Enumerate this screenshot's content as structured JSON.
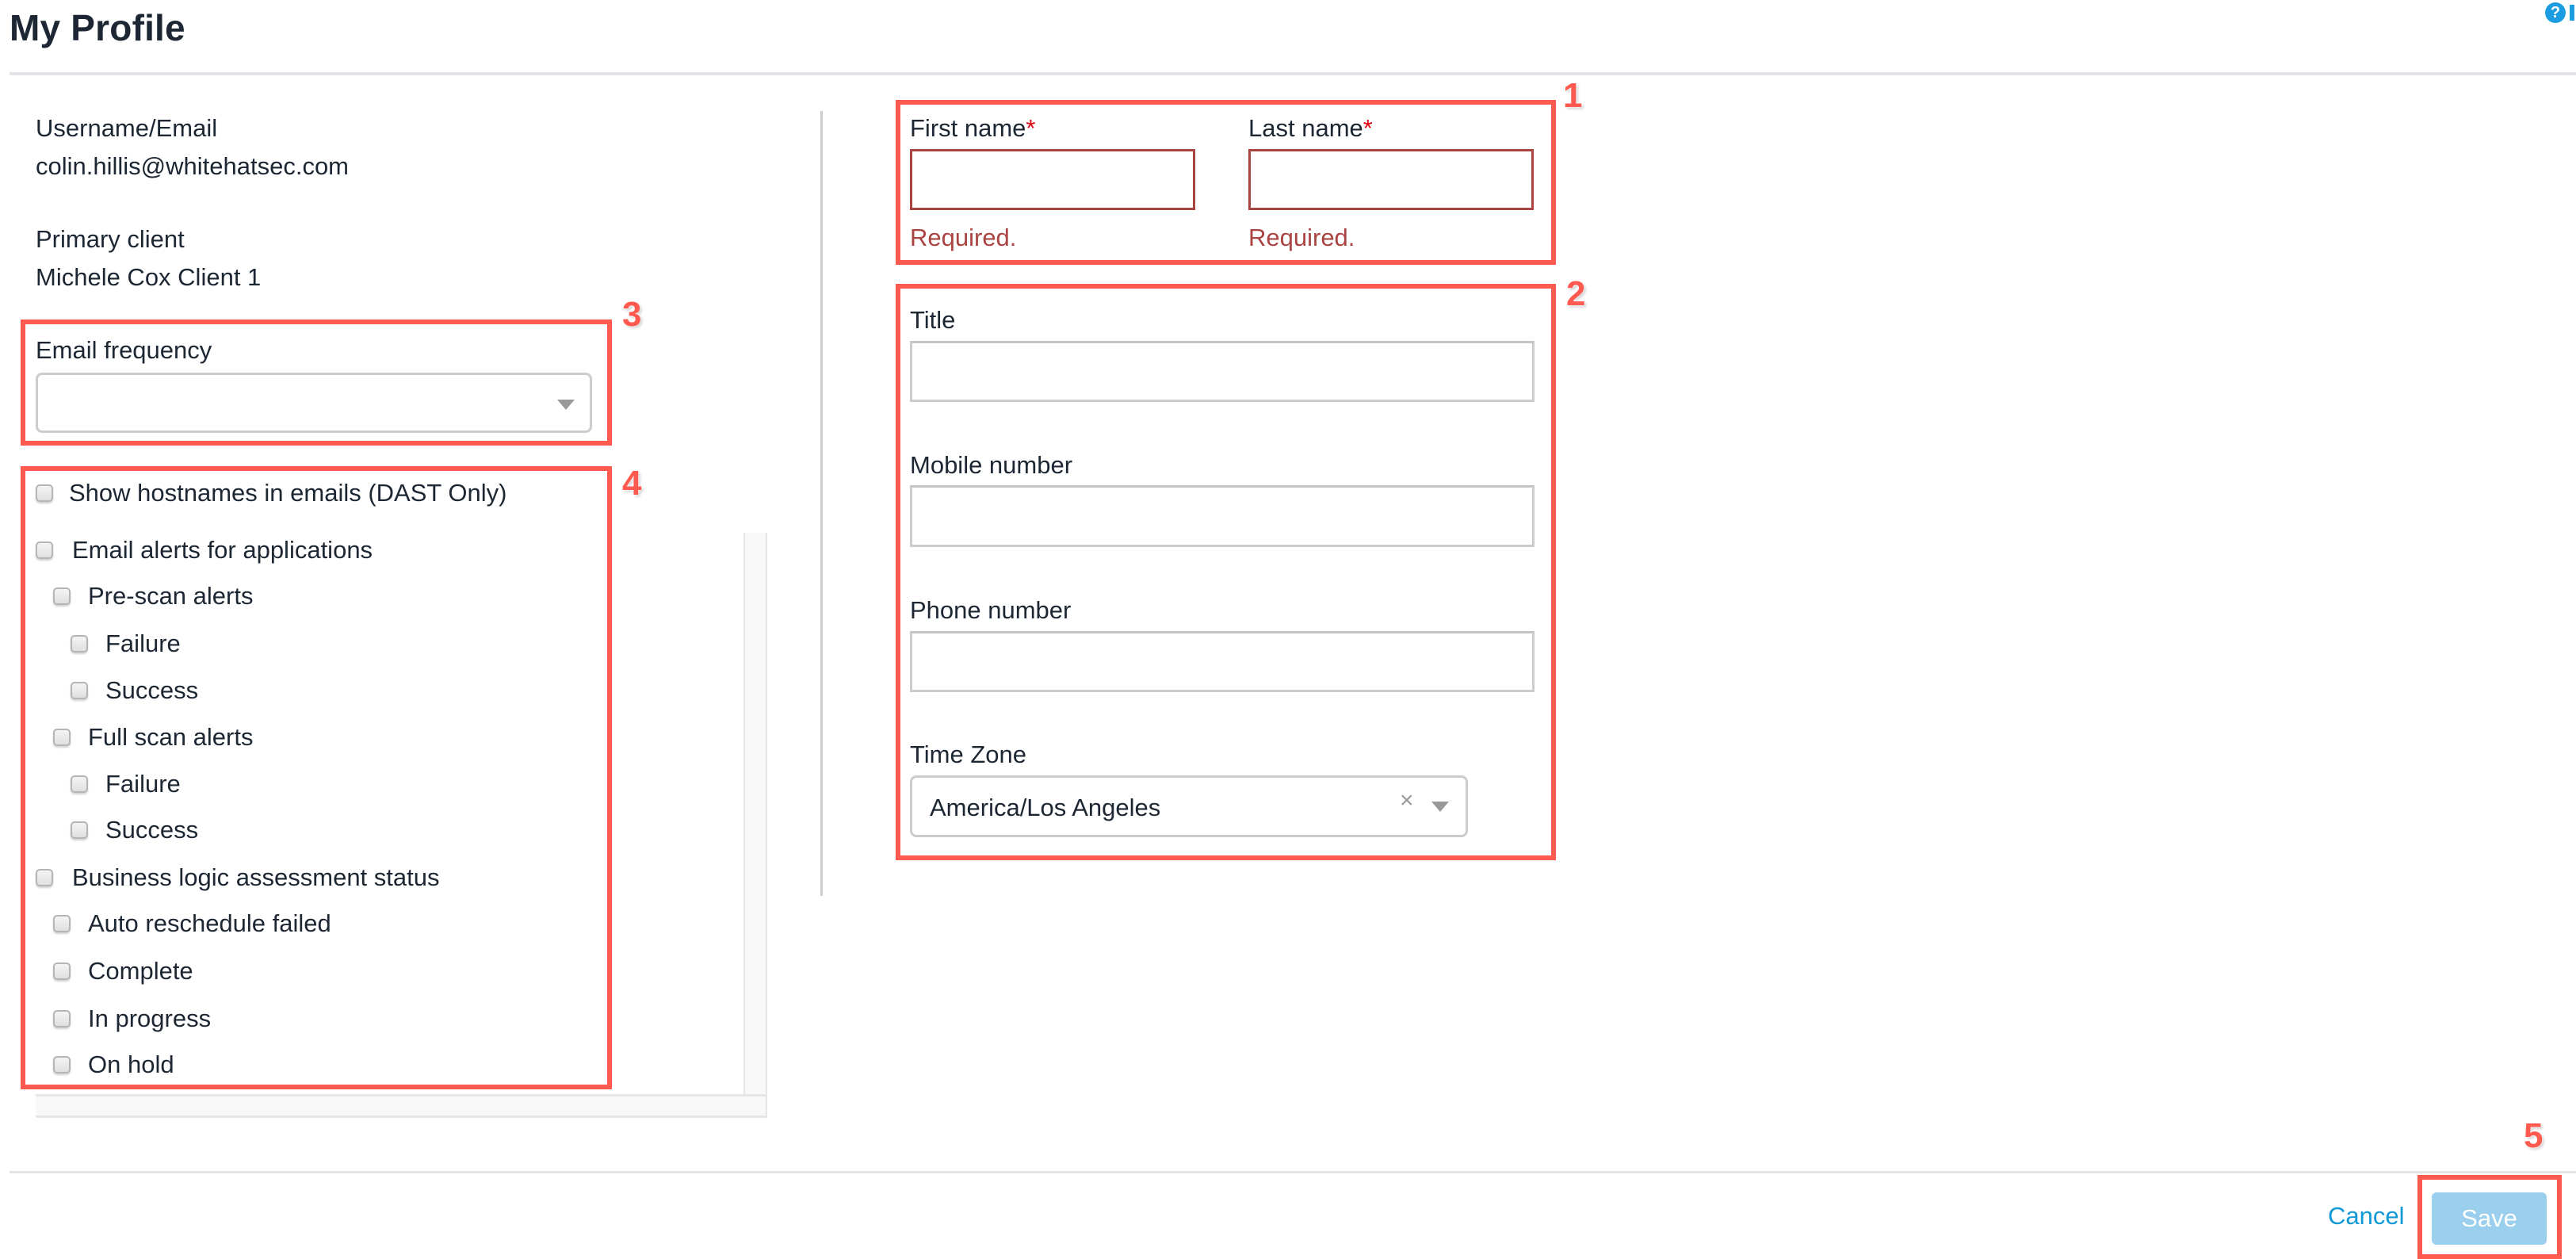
{
  "header": {
    "title": "My Profile",
    "help_icon": "question-circle-icon",
    "help_glyph": "?"
  },
  "account": {
    "username_label": "Username/Email",
    "username_value": "colin.hillis@whitehatsec.com",
    "primary_client_label": "Primary client",
    "primary_client_value": "Michele Cox Client 1"
  },
  "email_frequency": {
    "label": "Email frequency",
    "value": ""
  },
  "notifications": [
    {
      "label": "Show hostnames in emails (DAST Only)",
      "level": 0,
      "checked": false
    },
    {
      "label": "Email alerts for applications",
      "level": 0,
      "checked": false
    },
    {
      "label": "Pre-scan alerts",
      "level": 1,
      "checked": false
    },
    {
      "label": "Failure",
      "level": 2,
      "checked": false
    },
    {
      "label": "Success",
      "level": 2,
      "checked": false
    },
    {
      "label": "Full scan alerts",
      "level": 1,
      "checked": false
    },
    {
      "label": "Failure",
      "level": 2,
      "checked": false
    },
    {
      "label": "Success",
      "level": 2,
      "checked": false
    },
    {
      "label": "Business logic assessment status",
      "level": 0,
      "checked": false
    },
    {
      "label": "Auto reschedule failed",
      "level": 1,
      "checked": false
    },
    {
      "label": "Complete",
      "level": 1,
      "checked": false
    },
    {
      "label": "In progress",
      "level": 1,
      "checked": false
    },
    {
      "label": "On hold",
      "level": 1,
      "checked": false
    }
  ],
  "form": {
    "first_name": {
      "label": "First name",
      "required_mark": "*",
      "value": "",
      "error": "Required."
    },
    "last_name": {
      "label": "Last name",
      "required_mark": "*",
      "value": "",
      "error": "Required."
    },
    "title": {
      "label": "Title",
      "value": ""
    },
    "mobile": {
      "label": "Mobile number",
      "value": ""
    },
    "phone": {
      "label": "Phone number",
      "value": ""
    },
    "time_zone": {
      "label": "Time Zone",
      "value": "America/Los Angeles",
      "clear_glyph": "×"
    }
  },
  "footer": {
    "cancel_label": "Cancel",
    "save_label": "Save"
  },
  "annotations": [
    "1",
    "2",
    "3",
    "4",
    "5"
  ],
  "colors": {
    "accent": "#0f9ad6",
    "save_disabled": "#9bcfee",
    "error": "#a94442",
    "annotation": "#ff5a4f"
  }
}
